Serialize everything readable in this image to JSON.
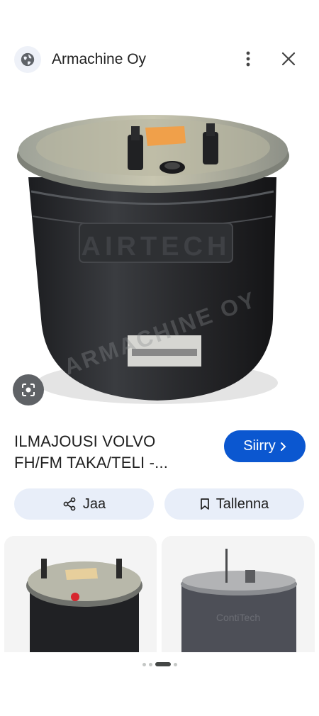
{
  "header": {
    "site_name": "Armachine Oy",
    "site_icon": "globe-icon",
    "more_icon": "more-vertical-icon",
    "close_icon": "close-icon"
  },
  "hero_image": {
    "label_lines": [
      "AIRTECH",
      "ARMACHINE OY"
    ]
  },
  "lens_icon": "google-lens-icon",
  "result": {
    "title_line1": "ILMAJOUSI VOLVO",
    "title_line2": "FH/FM TAKA/TELI -...",
    "visit_label": "Siirry",
    "visit_icon": "chevron-right-icon"
  },
  "actions": {
    "share_label": "Jaa",
    "share_icon": "share-icon",
    "save_label": "Tallenna",
    "save_icon": "bookmark-icon"
  },
  "related": [
    {
      "kind": "air-spring-thumbnail"
    },
    {
      "kind": "air-spring-thumbnail"
    }
  ],
  "pagination": {
    "count": 5,
    "active_index": 2
  },
  "colors": {
    "accent": "#0b57d0",
    "pill_bg": "#e8eef9"
  }
}
